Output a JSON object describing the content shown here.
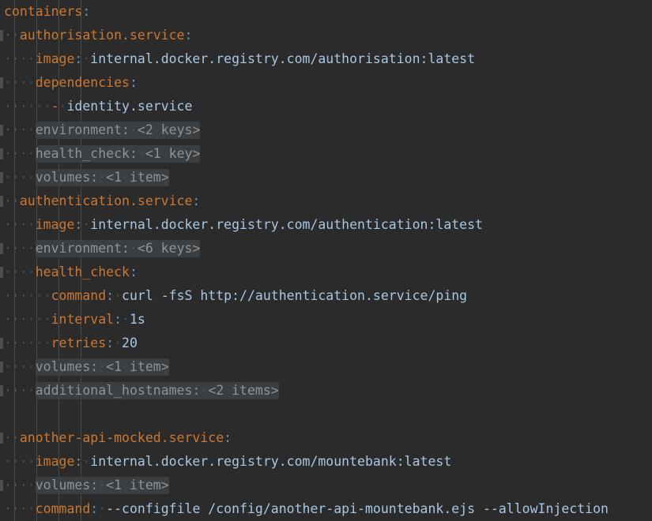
{
  "editor": {
    "theme": "darcula",
    "language": "yaml",
    "filetype": "docker-compose",
    "line_height_px": 30,
    "colors": {
      "background": "#2b2b2b",
      "key": "#cc7832",
      "colon": "#6897bb",
      "value": "#a9c7e4",
      "folded_background": "#3c3f41",
      "folded_text": "#8f9396",
      "indent_guide": "#4a4a4a",
      "whitespace_dot": "#4f4f4f"
    },
    "indent_guides_x": [
      18,
      46,
      74,
      102
    ],
    "lines": [
      {
        "id": "containers",
        "indent": 0,
        "folded": false,
        "fold_nub": false,
        "key": "containers",
        "value": "",
        "text": "containers:"
      },
      {
        "id": "authorisation-service",
        "indent": 1,
        "folded": false,
        "fold_nub": true,
        "key": "authorisation.service",
        "value": "",
        "text": "authorisation.service:"
      },
      {
        "id": "authorisation-image",
        "indent": 2,
        "folded": false,
        "fold_nub": false,
        "key": "image",
        "value": "internal.docker.registry.com/authorisation:latest",
        "text": "image: internal.docker.registry.com/authorisation:latest"
      },
      {
        "id": "authorisation-dependencies",
        "indent": 2,
        "folded": false,
        "fold_nub": true,
        "key": "dependencies",
        "value": "",
        "text": "dependencies:"
      },
      {
        "id": "authorisation-dependency-item",
        "indent": 3,
        "folded": false,
        "fold_nub": false,
        "list_item": true,
        "key": "",
        "value": "identity.service",
        "text": "- identity.service"
      },
      {
        "id": "authorisation-environment",
        "indent": 2,
        "folded": true,
        "fold_nub": true,
        "key": "environment",
        "value": "<2 keys>",
        "text": "environment: <2 keys>"
      },
      {
        "id": "authorisation-health-check",
        "indent": 2,
        "folded": true,
        "fold_nub": true,
        "key": "health_check",
        "value": "<1 key>",
        "text": "health_check: <1 key>"
      },
      {
        "id": "authorisation-volumes",
        "indent": 2,
        "folded": true,
        "fold_nub": true,
        "key": "volumes",
        "value": "<1 item>",
        "text": "volumes: <1 item>"
      },
      {
        "id": "authentication-service",
        "indent": 1,
        "folded": false,
        "fold_nub": true,
        "key": "authentication.service",
        "value": "",
        "text": "authentication.service:"
      },
      {
        "id": "authentication-image",
        "indent": 2,
        "folded": false,
        "fold_nub": false,
        "key": "image",
        "value": "internal.docker.registry.com/authentication:latest",
        "text": "image: internal.docker.registry.com/authentication:latest"
      },
      {
        "id": "authentication-environment",
        "indent": 2,
        "folded": true,
        "fold_nub": true,
        "key": "environment",
        "value": "<6 keys>",
        "text": "environment: <6 keys>"
      },
      {
        "id": "authentication-health-check",
        "indent": 2,
        "folded": false,
        "fold_nub": true,
        "key": "health_check",
        "value": "",
        "text": "health_check:"
      },
      {
        "id": "authentication-health-check-command",
        "indent": 3,
        "folded": false,
        "fold_nub": false,
        "key": "command",
        "value": "curl -fsS http://authentication.service/ping",
        "text": "command: curl -fsS http://authentication.service/ping"
      },
      {
        "id": "authentication-health-check-interval",
        "indent": 3,
        "folded": false,
        "fold_nub": false,
        "key": "interval",
        "value": "1s",
        "text": "interval: 1s"
      },
      {
        "id": "authentication-health-check-retries",
        "indent": 3,
        "folded": false,
        "fold_nub": true,
        "key": "retries",
        "value": "20",
        "text": "retries: 20"
      },
      {
        "id": "authentication-volumes",
        "indent": 2,
        "folded": true,
        "fold_nub": true,
        "key": "volumes",
        "value": "<1 item>",
        "text": "volumes: <1 item>"
      },
      {
        "id": "authentication-additional-hostnames",
        "indent": 2,
        "folded": true,
        "fold_nub": true,
        "key": "additional_hostnames",
        "value": "<2 items>",
        "text": "additional_hostnames: <2 items>"
      },
      {
        "id": "blank-1",
        "indent": 0,
        "folded": false,
        "fold_nub": false,
        "blank": true,
        "key": "",
        "value": "",
        "text": ""
      },
      {
        "id": "another-api-mocked-service",
        "indent": 1,
        "folded": false,
        "fold_nub": true,
        "key": "another-api-mocked.service",
        "value": "",
        "text": "another-api-mocked.service:"
      },
      {
        "id": "another-api-mocked-image",
        "indent": 2,
        "folded": false,
        "fold_nub": false,
        "key": "image",
        "value": "internal.docker.registry.com/mountebank:latest",
        "text": "image: internal.docker.registry.com/mountebank:latest"
      },
      {
        "id": "another-api-mocked-volumes",
        "indent": 2,
        "folded": true,
        "fold_nub": true,
        "key": "volumes",
        "value": "<1 item>",
        "text": "volumes: <1 item>"
      },
      {
        "id": "another-api-mocked-command",
        "indent": 2,
        "folded": false,
        "fold_nub": false,
        "key": "command",
        "value": "--configfile /config/another-api-mountebank.ejs --allowInjection",
        "text": "command: --configfile /config/another-api-mountebank.ejs --allowInjection"
      }
    ]
  }
}
